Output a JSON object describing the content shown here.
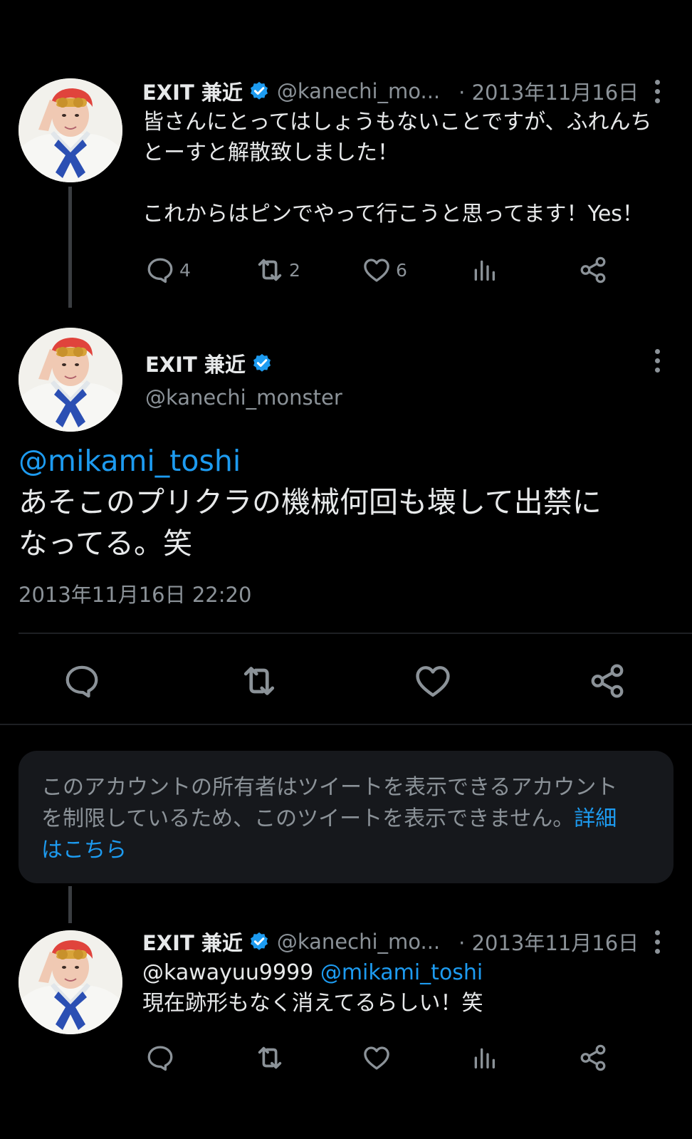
{
  "tweet1": {
    "name": "EXIT 兼近",
    "handle": "@kanechi_mo...",
    "date": "· 2013年11月16日",
    "line1": "皆さんにとってはしょうもないことですが、ふれんち",
    "line2": "とーすと解散致しました！",
    "line3": "これからはピンでやって行こうと思ってます！Yes！",
    "replies": "4",
    "retweets": "2",
    "likes": "6"
  },
  "tweet2": {
    "name": "EXIT 兼近",
    "handle": "@kanechi_monster",
    "mention": "@mikami_toshi",
    "line1": "あそこのプリクラの機械何回も壊して出禁に",
    "line2": "なってる。笑",
    "timestamp": "2013年11月16日 22:20"
  },
  "notice": {
    "line1": "このアカウントの所有者はツイートを表示できるアカウント",
    "line2": "を制限しているため、このツイートを表示できません。",
    "link1": "詳細",
    "link2": "はこちら"
  },
  "tweet3": {
    "name": "EXIT 兼近",
    "handle": "@kanechi_mo...",
    "date": "· 2013年11月16日",
    "reply_to": "@kawayuu9999",
    "mention": "@mikami_toshi",
    "line1": "現在跡形もなく消えてるらしい！笑"
  },
  "icons": {
    "reply": "reply-icon",
    "retweet": "retweet-icon",
    "like": "heart-icon",
    "views": "views-icon",
    "share": "share-icon",
    "verified": "verified-badge-icon",
    "more": "more-icon"
  },
  "colors": {
    "background": "#000000",
    "text": "#e7e9ea",
    "secondary": "#8b9298",
    "link": "#1d9bf0",
    "verified": "#1d9bf0",
    "notice_bg": "#16181c"
  }
}
